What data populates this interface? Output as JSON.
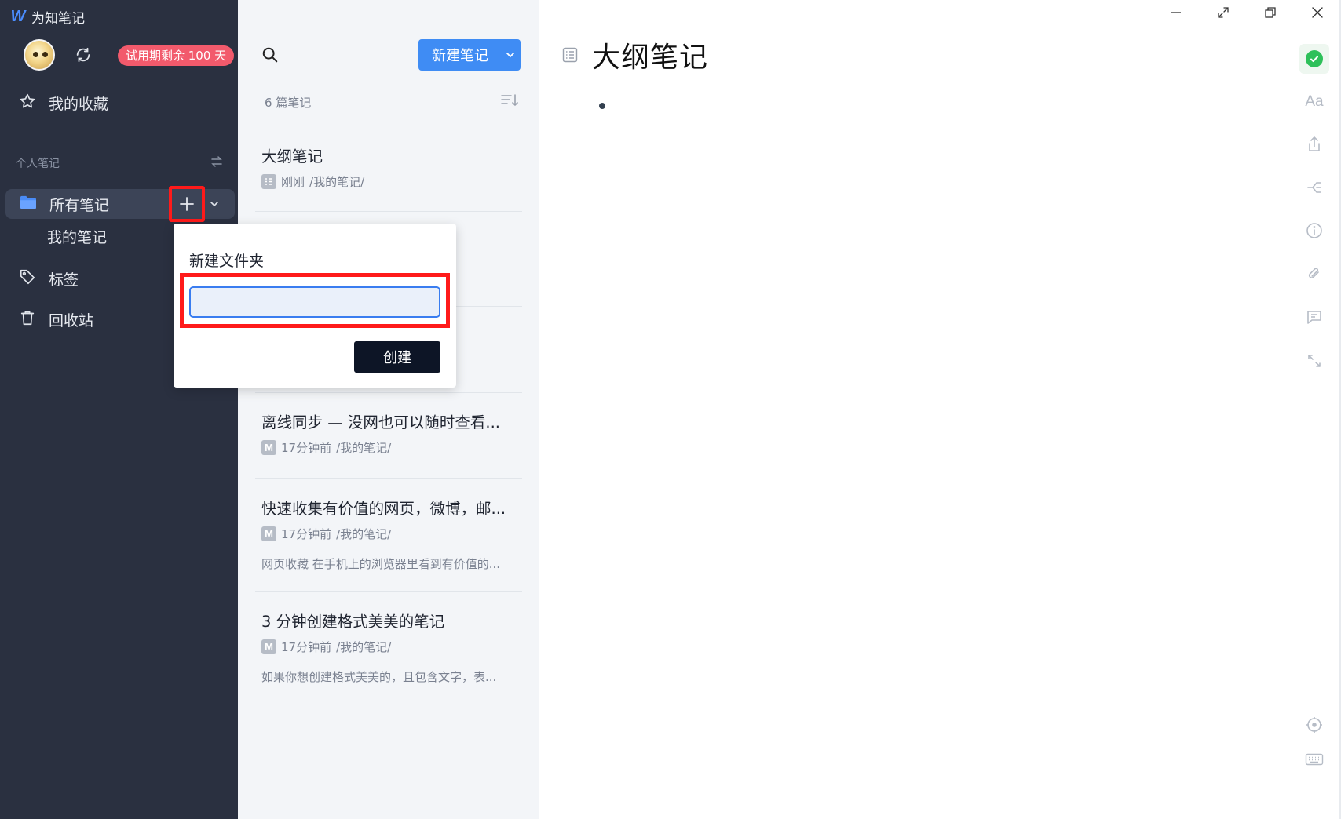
{
  "app": {
    "title": "为知笔记",
    "logo_letter": "W",
    "trial_badge": "试用期剩余 100 天"
  },
  "sidebar": {
    "favorites_label": "我的收藏",
    "section_label": "个人笔记",
    "all_notes_label": "所有笔记",
    "sub_folder_label": "我的笔记",
    "tags_label": "标签",
    "trash_label": "回收站"
  },
  "notelist": {
    "new_note_label": "新建笔记",
    "count_label": "6 篇笔记",
    "notes": [
      {
        "title": "大纲笔记",
        "time": "刚刚",
        "path": "/我的笔记/",
        "preview": "",
        "type_icon": "outline-note-icon"
      },
      {
        "title": "",
        "time": "",
        "path": "",
        "preview": "",
        "type_icon": ""
      },
      {
        "title": "",
        "time": "",
        "path": "",
        "preview": "",
        "type_icon": ""
      },
      {
        "title": "离线同步 — 没网也可以随时查看...",
        "time": "17分钟前",
        "path": "/我的笔记/",
        "preview": "",
        "type_icon": "markdown-icon"
      },
      {
        "title": "快速收集有价值的网页，微博，邮...",
        "time": "17分钟前",
        "path": "/我的笔记/",
        "preview": "网页收藏 在手机上的浏览器里看到有价值的...",
        "type_icon": "markdown-icon"
      },
      {
        "title": "3 分钟创建格式美美的笔记",
        "time": "17分钟前",
        "path": "/我的笔记/",
        "preview": "如果你想创建格式美美的，且包含文字，表...",
        "type_icon": "markdown-icon"
      }
    ]
  },
  "popup": {
    "title": "新建文件夹",
    "input_value": "",
    "input_placeholder": "",
    "create_label": "创建"
  },
  "editor": {
    "title": "大纲笔记"
  },
  "right_tools": {
    "font_label": "Aa"
  },
  "colors": {
    "sidebar_bg": "#2a3040",
    "accent_blue": "#3f8cf4",
    "trial_badge": "#f25a6c",
    "highlight_red": "#ff1a1a",
    "status_green": "#2ec05a"
  }
}
